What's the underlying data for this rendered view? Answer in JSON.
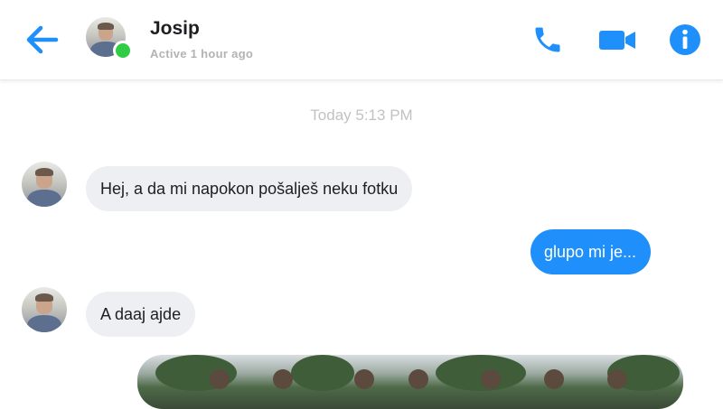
{
  "header": {
    "contact_name": "Josip",
    "status": "Active 1 hour ago",
    "back_icon": "arrow-left-icon",
    "actions": [
      "phone-icon",
      "video-camera-icon",
      "info-icon"
    ]
  },
  "timestamp": "Today 5:13 PM",
  "messages": [
    {
      "direction": "incoming",
      "text": "Hej, a da mi napokon pošalješ neku fotku"
    },
    {
      "direction": "outgoing",
      "text": "glupo mi je..."
    },
    {
      "direction": "incoming",
      "text": "A daaj ajde"
    },
    {
      "direction": "outgoing",
      "type": "photo"
    }
  ],
  "colors": {
    "accent": "#1e8ffb",
    "online": "#31cc46",
    "incoming_bubble": "#eeeff2",
    "timestamp": "#c2c2c2"
  }
}
